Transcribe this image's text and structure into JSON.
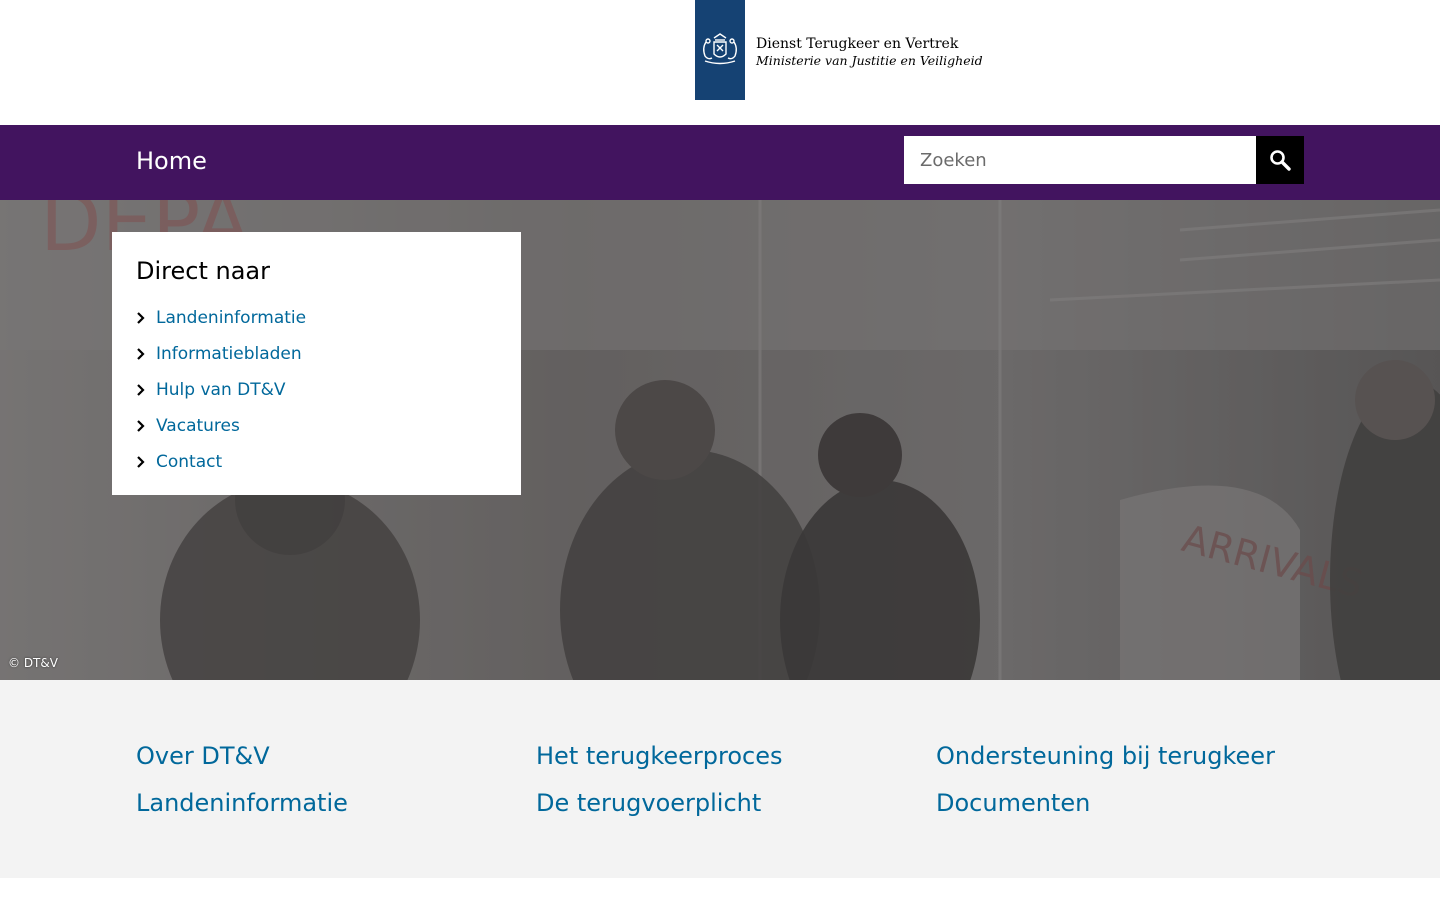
{
  "header": {
    "logo": {
      "line1": "Dienst Terugkeer en Vertrek",
      "line2": "Ministerie van Justitie en Veiligheid",
      "icon": "coat-of-arms-icon",
      "ribbon_color": "#154273"
    }
  },
  "nav": {
    "home_label": "Home",
    "bar_color": "#42145f"
  },
  "search": {
    "placeholder": "Zoeken",
    "value": "",
    "button_icon": "search-icon"
  },
  "hero": {
    "credit": "© DT&V",
    "direct": {
      "title": "Direct naar",
      "items": [
        {
          "label": "Landeninformatie",
          "icon": "chevron-right-icon"
        },
        {
          "label": "Informatiebladen",
          "icon": "chevron-right-icon"
        },
        {
          "label": "Hulp van DT&V",
          "icon": "chevron-right-icon"
        },
        {
          "label": "Vacatures",
          "icon": "chevron-right-icon"
        },
        {
          "label": "Contact",
          "icon": "chevron-right-icon"
        }
      ]
    }
  },
  "links": {
    "items": [
      "Over DT&V",
      "Het terugkeerproces",
      "Ondersteuning bij terugkeer",
      "Landeninformatie",
      "De terugvoerplicht",
      "Documenten"
    ],
    "color": "#01689b"
  }
}
